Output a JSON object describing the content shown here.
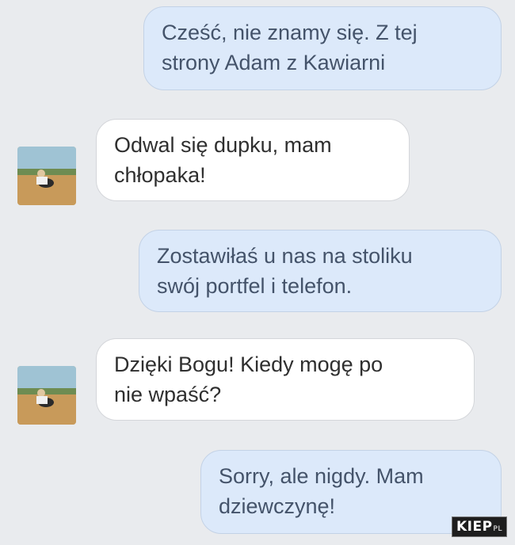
{
  "messages": [
    {
      "direction": "outgoing",
      "text": "Cześć, nie znamy się. Z tej\nstrony Adam z Kawiarni"
    },
    {
      "direction": "incoming",
      "text": "Odwal się dupku, mam\nchłopaka!"
    },
    {
      "direction": "outgoing",
      "text": "Zostawiłaś u nas na stoliku\nswój portfel i telefon."
    },
    {
      "direction": "incoming",
      "text": "Dzięki Bogu! Kiedy mogę po\nnie wpaść?"
    },
    {
      "direction": "outgoing",
      "text": "Sorry, ale nigdy. Mam\ndziewczynę!"
    }
  ],
  "watermark": {
    "main": "KIEP",
    "sub": "PL"
  },
  "colors": {
    "background": "#e9ebee",
    "outgoing_bubble": "#dce9fa",
    "incoming_bubble": "#ffffff"
  }
}
